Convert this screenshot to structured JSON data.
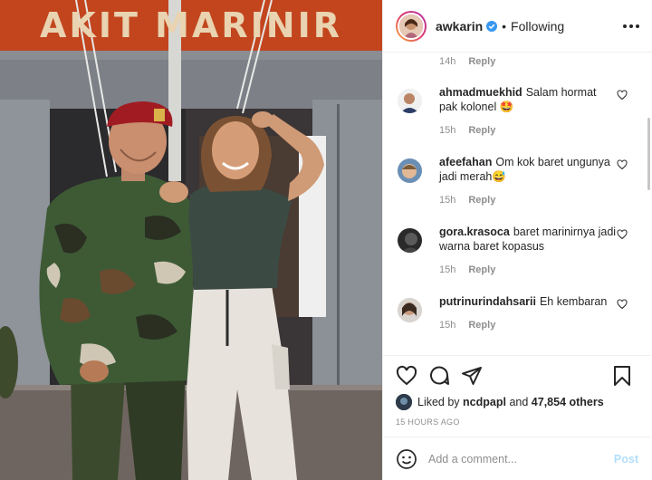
{
  "photo": {
    "sign_text": "AKIT MARINIR"
  },
  "header": {
    "username": "awkarin",
    "verified": true,
    "separator": "•",
    "follow_status": "Following"
  },
  "comments": {
    "previous_meta": {
      "time": "14h",
      "reply": "Reply"
    },
    "items": [
      {
        "user": "ahmadmuekhid",
        "text": "Salam hormat pak kolonel 🤩",
        "time": "15h",
        "reply": "Reply"
      },
      {
        "user": "afeefahan",
        "text": "Om kok baret ungunya jadi merah😅",
        "time": "15h",
        "reply": "Reply"
      },
      {
        "user": "gora.krasoca",
        "text": "baret marinirnya jadi warna baret kopasus",
        "time": "15h",
        "reply": "Reply"
      },
      {
        "user": "putrinurindahsarii",
        "text": "Eh kembaran",
        "time": "15h",
        "reply": "Reply"
      }
    ]
  },
  "likes": {
    "prefix": "Liked by",
    "liker": "ncdpapl",
    "joiner": "and",
    "others": "47,854 others",
    "time_ago": "15 HOURS AGO"
  },
  "composer": {
    "placeholder": "Add a comment...",
    "post_label": "Post"
  },
  "colors": {
    "text": "#262626",
    "muted": "#8e8e8e",
    "post_disabled": "#b2dffc",
    "verified_blue": "#3897f0",
    "beret_red": "#a11c22"
  },
  "icons": [
    "verified-badge-icon",
    "more-options-icon",
    "heart-icon",
    "comment-icon",
    "share-icon",
    "bookmark-icon",
    "emoji-icon"
  ]
}
